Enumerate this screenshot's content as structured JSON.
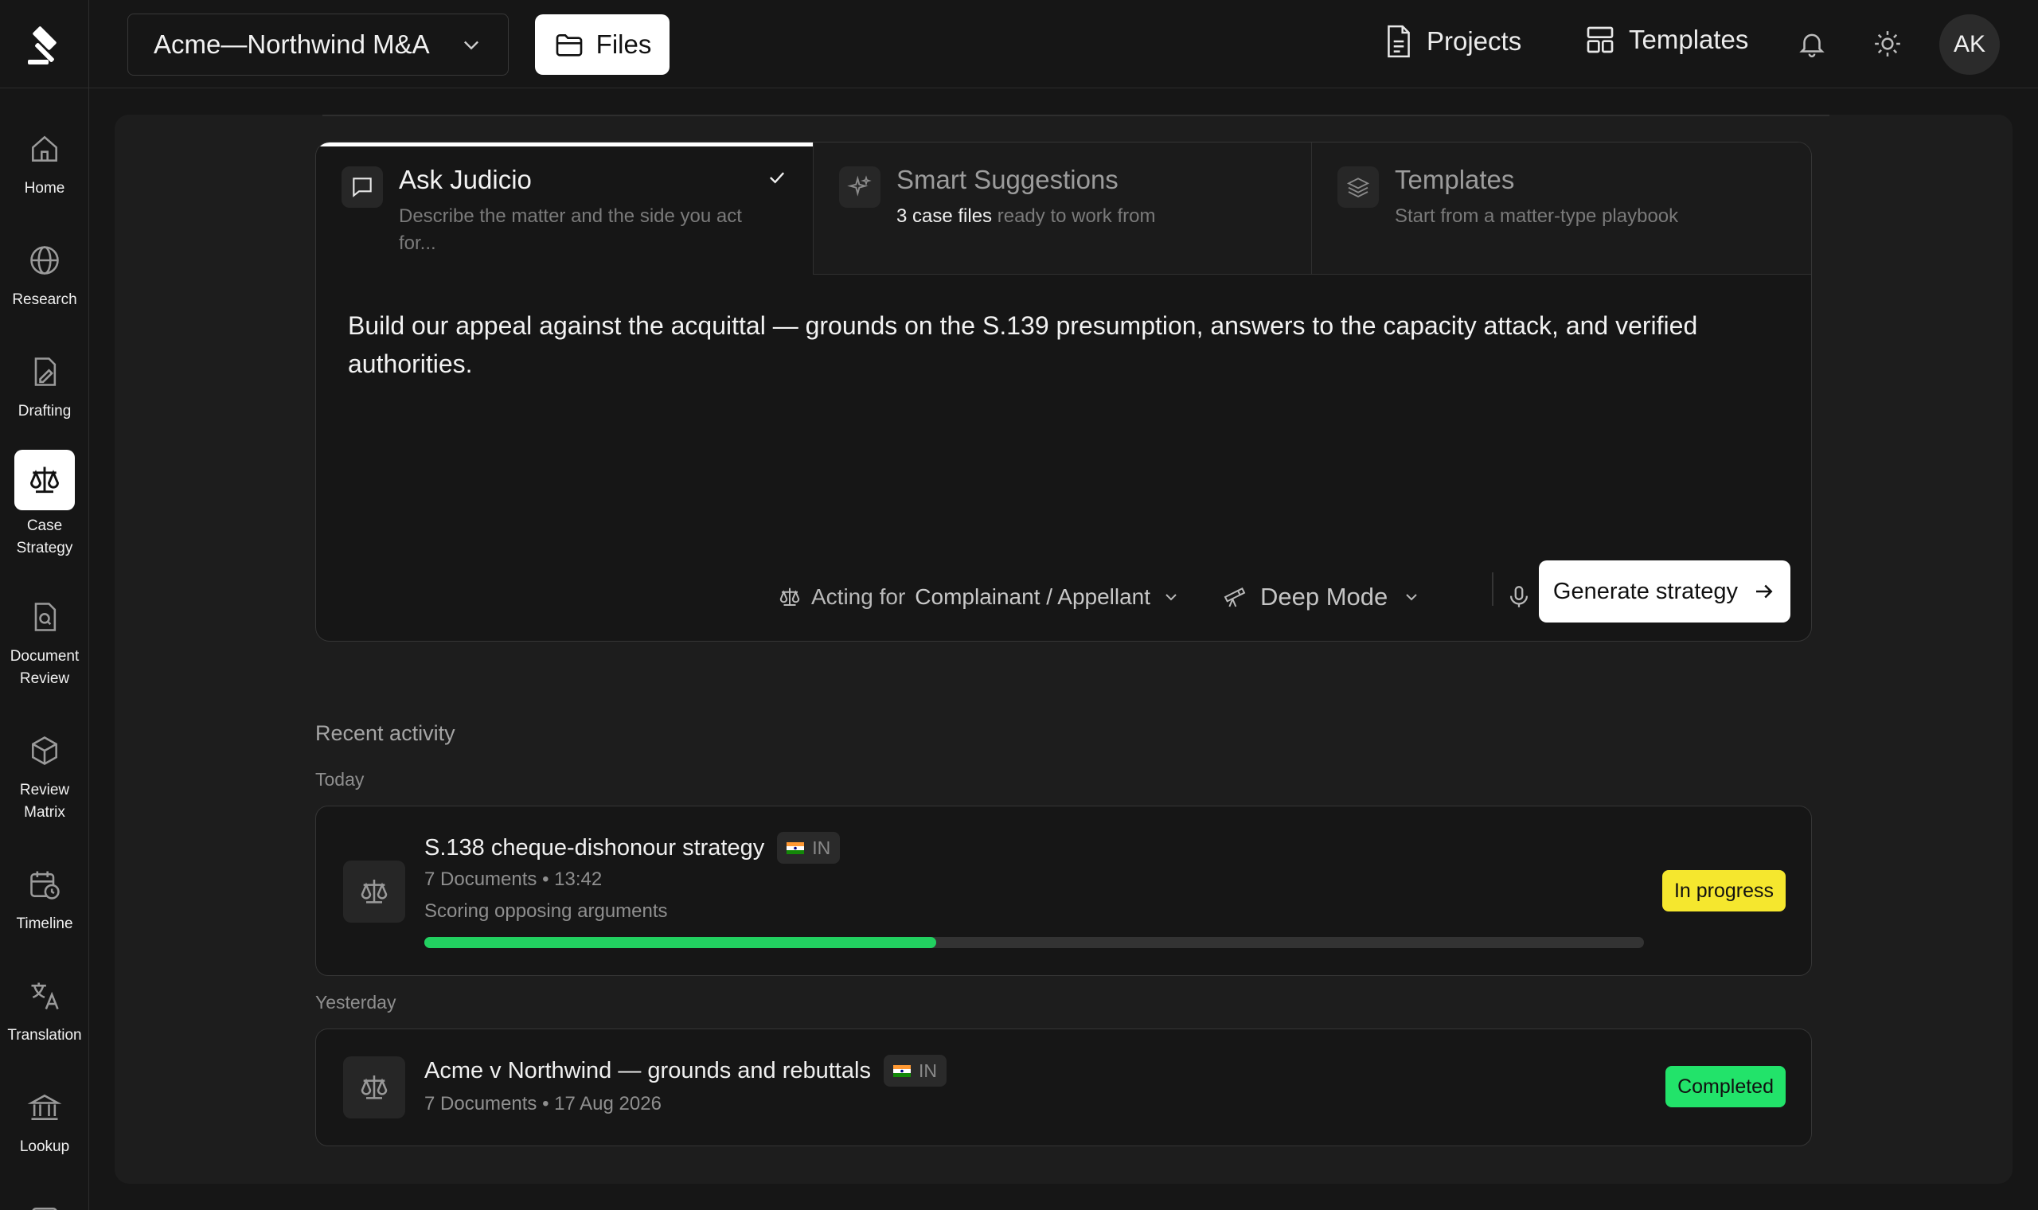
{
  "header": {
    "project_name": "Acme—Northwind M&A",
    "files_label": "Files",
    "projects_label": "Projects",
    "templates_label": "Templates",
    "avatar_initials": "AK"
  },
  "sidebar": {
    "items": [
      {
        "label": "Home",
        "icon": "home-icon"
      },
      {
        "label": "Research",
        "icon": "globe-icon"
      },
      {
        "label": "Drafting",
        "icon": "pen-document-icon"
      },
      {
        "label": "Case Strategy",
        "icon": "scales-icon",
        "active": true
      },
      {
        "label": "Document Review",
        "icon": "document-search-icon"
      },
      {
        "label": "Review Matrix",
        "icon": "cube-icon"
      },
      {
        "label": "Timeline",
        "icon": "calendar-clock-icon"
      },
      {
        "label": "Translation",
        "icon": "translate-icon"
      },
      {
        "label": "Lookup",
        "icon": "bank-icon"
      }
    ]
  },
  "composer": {
    "tabs": [
      {
        "title": "Ask Judicio",
        "subtitle": "Describe the matter and the side you act for...",
        "active": true
      },
      {
        "title": "Smart Suggestions",
        "subtitle_highlight": "3 case files",
        "subtitle_rest": "ready to work from"
      },
      {
        "title": "Templates",
        "subtitle": "Start from a matter-type playbook"
      }
    ],
    "prompt": "Build our appeal against the acquittal — grounds on the S.139 presumption, answers to the capacity attack, and verified authorities.",
    "acting_for_prefix": "Acting for",
    "acting_for_value": "Complainant / Appellant",
    "mode": "Deep Mode",
    "generate_label": "Generate strategy"
  },
  "activity": {
    "title": "Recent activity",
    "groups": [
      {
        "day": "Today",
        "items": [
          {
            "title": "S.138 cheque-dishonour strategy",
            "flag": "IN",
            "meta": "7 Documents • 13:42",
            "step": "Scoring opposing arguments",
            "progress": 0.42,
            "status": "In progress",
            "status_color": "#f5e72e"
          }
        ]
      },
      {
        "day": "Yesterday",
        "items": [
          {
            "title": "Acme v Northwind — grounds and rebuttals",
            "flag": "IN",
            "meta": "7 Documents • 17 Aug 2026",
            "status": "Completed",
            "status_color": "#22e36a"
          }
        ]
      }
    ]
  },
  "colors": {
    "progress_fill": "#22d060",
    "in_progress": "#f5e72e",
    "completed": "#22e36a"
  }
}
